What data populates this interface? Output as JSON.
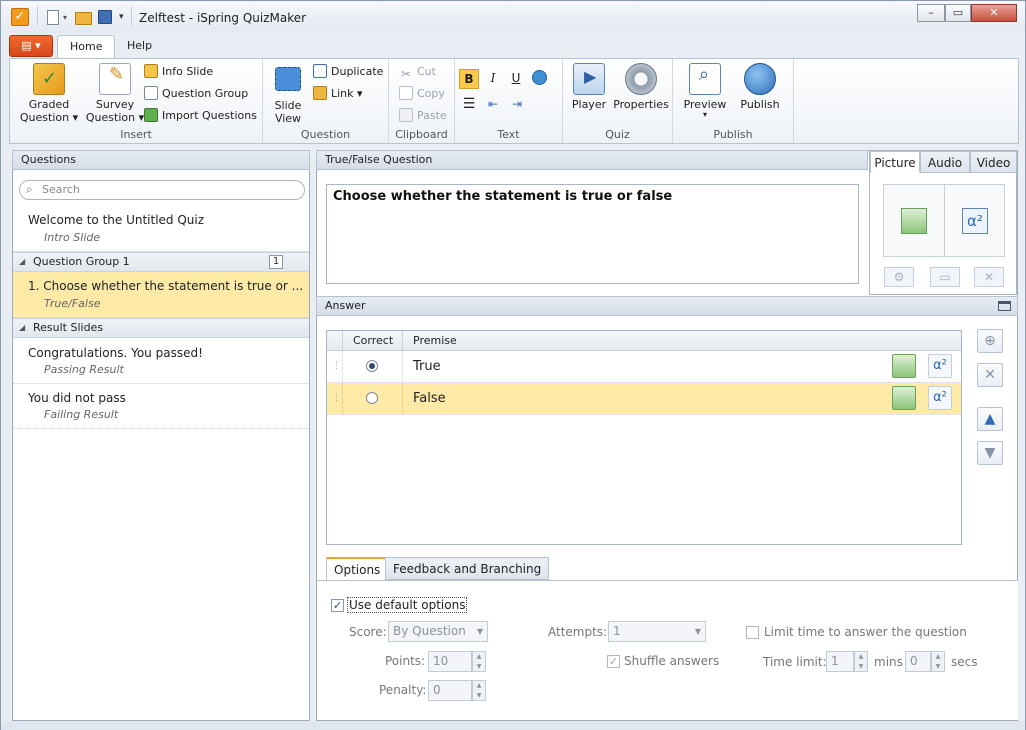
{
  "window": {
    "title": "Zelftest - iSpring QuizMaker"
  },
  "ribbon": {
    "tabs": [
      "Home",
      "Help"
    ],
    "insert": {
      "graded_question": "Graded Question",
      "survey_question": "Survey Question",
      "info_slide": "Info Slide",
      "question_group": "Question Group",
      "import_questions": "Import Questions",
      "label": "Insert"
    },
    "question": {
      "slide_view": "Slide View",
      "duplicate": "Duplicate",
      "link": "Link",
      "label": "Question"
    },
    "clipboard": {
      "cut": "Cut",
      "copy": "Copy",
      "paste": "Paste",
      "label": "Clipboard"
    },
    "text": {
      "label": "Text",
      "bold": "B",
      "italic": "I",
      "underline": "U"
    },
    "quiz": {
      "player": "Player",
      "properties": "Properties",
      "label": "Quiz"
    },
    "publish": {
      "preview": "Preview",
      "publish": "Publish",
      "label": "Publish"
    }
  },
  "questions_panel": {
    "header": "Questions",
    "search_placeholder": "Search",
    "intro": {
      "title": "Welcome to the Untitled Quiz",
      "subtitle": "Intro Slide"
    },
    "group": {
      "label": "Question Group 1",
      "count": "1"
    },
    "question1": {
      "title": "1. Choose whether the statement is true or ...",
      "subtitle": "True/False"
    },
    "results_group": {
      "label": "Result Slides"
    },
    "passed": {
      "title": "Congratulations. You passed!",
      "subtitle": "Passing Result"
    },
    "failed": {
      "title": "You did not pass",
      "subtitle": "Failing Result"
    }
  },
  "editor": {
    "header": "True/False Question",
    "question_text": "Choose whether the statement is true or false",
    "media_tabs": [
      "Picture",
      "Audio",
      "Video"
    ]
  },
  "answer": {
    "header": "Answer",
    "columns": [
      "Correct",
      "Premise"
    ],
    "rows": [
      {
        "premise": "True",
        "correct": true
      },
      {
        "premise": "False",
        "correct": false
      }
    ]
  },
  "options": {
    "tabs": [
      "Options",
      "Feedback and Branching"
    ],
    "use_default": "Use default options",
    "score_label": "Score:",
    "score_value": "By Question",
    "points_label": "Points:",
    "points_value": "10",
    "penalty_label": "Penalty:",
    "penalty_value": "0",
    "attempts_label": "Attempts:",
    "attempts_value": "1",
    "shuffle": "Shuffle answers",
    "limit_time": "Limit time to answer the question",
    "time_limit_label": "Time limit:",
    "time_mins_value": "1",
    "mins": "mins",
    "time_secs_value": "0",
    "secs": "secs"
  },
  "colors": {
    "selection": "#fdeaa7",
    "accent": "#f3a328",
    "brand": "#e85a22"
  }
}
